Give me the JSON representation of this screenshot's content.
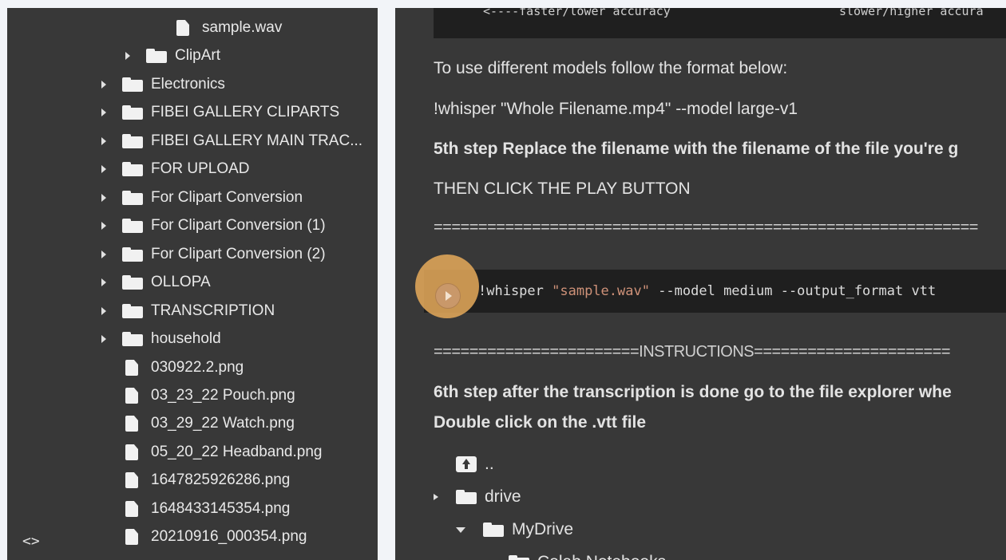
{
  "file_browser": {
    "items": [
      {
        "type": "file",
        "name": "sample.wav",
        "expandable": false
      },
      {
        "type": "folder",
        "name": "ClipArt",
        "expandable": true
      },
      {
        "type": "folder",
        "name": "Electronics",
        "expandable": true
      },
      {
        "type": "folder",
        "name": "FIBEI GALLERY CLIPARTS",
        "expandable": true
      },
      {
        "type": "folder",
        "name": "FIBEI GALLERY MAIN TRAC...",
        "expandable": true
      },
      {
        "type": "folder",
        "name": "FOR UPLOAD",
        "expandable": true
      },
      {
        "type": "folder",
        "name": "For Clipart Conversion",
        "expandable": true
      },
      {
        "type": "folder",
        "name": "For Clipart Conversion (1)",
        "expandable": true
      },
      {
        "type": "folder",
        "name": "For Clipart Conversion (2)",
        "expandable": true
      },
      {
        "type": "folder",
        "name": "OLLOPA",
        "expandable": true
      },
      {
        "type": "folder",
        "name": "TRANSCRIPTION",
        "expandable": true
      },
      {
        "type": "folder",
        "name": "household",
        "expandable": true
      },
      {
        "type": "file",
        "name": "030922.2.png",
        "expandable": false
      },
      {
        "type": "file",
        "name": "03_23_22 Pouch.png",
        "expandable": false
      },
      {
        "type": "file",
        "name": "03_29_22 Watch.png",
        "expandable": false
      },
      {
        "type": "file",
        "name": "05_20_22 Headband.png",
        "expandable": false
      },
      {
        "type": "file",
        "name": "1647825926286.png",
        "expandable": false
      },
      {
        "type": "file",
        "name": "1648433145354.png",
        "expandable": false
      },
      {
        "type": "file",
        "name": "20210916_000354.png",
        "expandable": false
      }
    ],
    "code_toggle_label": "<>"
  },
  "notebook": {
    "top_code": {
      "left": "<----faster/lower accuracy",
      "right": "slower/higher accura"
    },
    "text_model_format": "To use different models follow the format below:",
    "text_model_example": "!whisper \"Whole Filename.mp4\" --model large-v1",
    "text_step5": "5th step Replace the filename with the filename of the file you're g",
    "text_play": "THEN CLICK THE PLAY BUTTON",
    "divider_line": "=============================================================",
    "run_cell": {
      "prefix": "!whisper ",
      "string": "\"sample.wav\"",
      "suffix": " --model medium --output_format vtt"
    },
    "instructions_divider": "=======================INSTRUCTIONS======================",
    "text_step6": "6th step after the transcription is done go to the file explorer whe",
    "text_double_click": "Double click on the .vtt file",
    "mini_explorer": {
      "up_label": "..",
      "drive_label": "drive",
      "mydrive_label": "MyDrive",
      "colab_label": "Colab Notebooks"
    }
  },
  "colors": {
    "panel_bg": "#383838",
    "page_bg": "#f2f4f8",
    "code_bg": "#1f1f1f",
    "string_color": "#ce9178",
    "highlight": "#e6aa5a"
  }
}
